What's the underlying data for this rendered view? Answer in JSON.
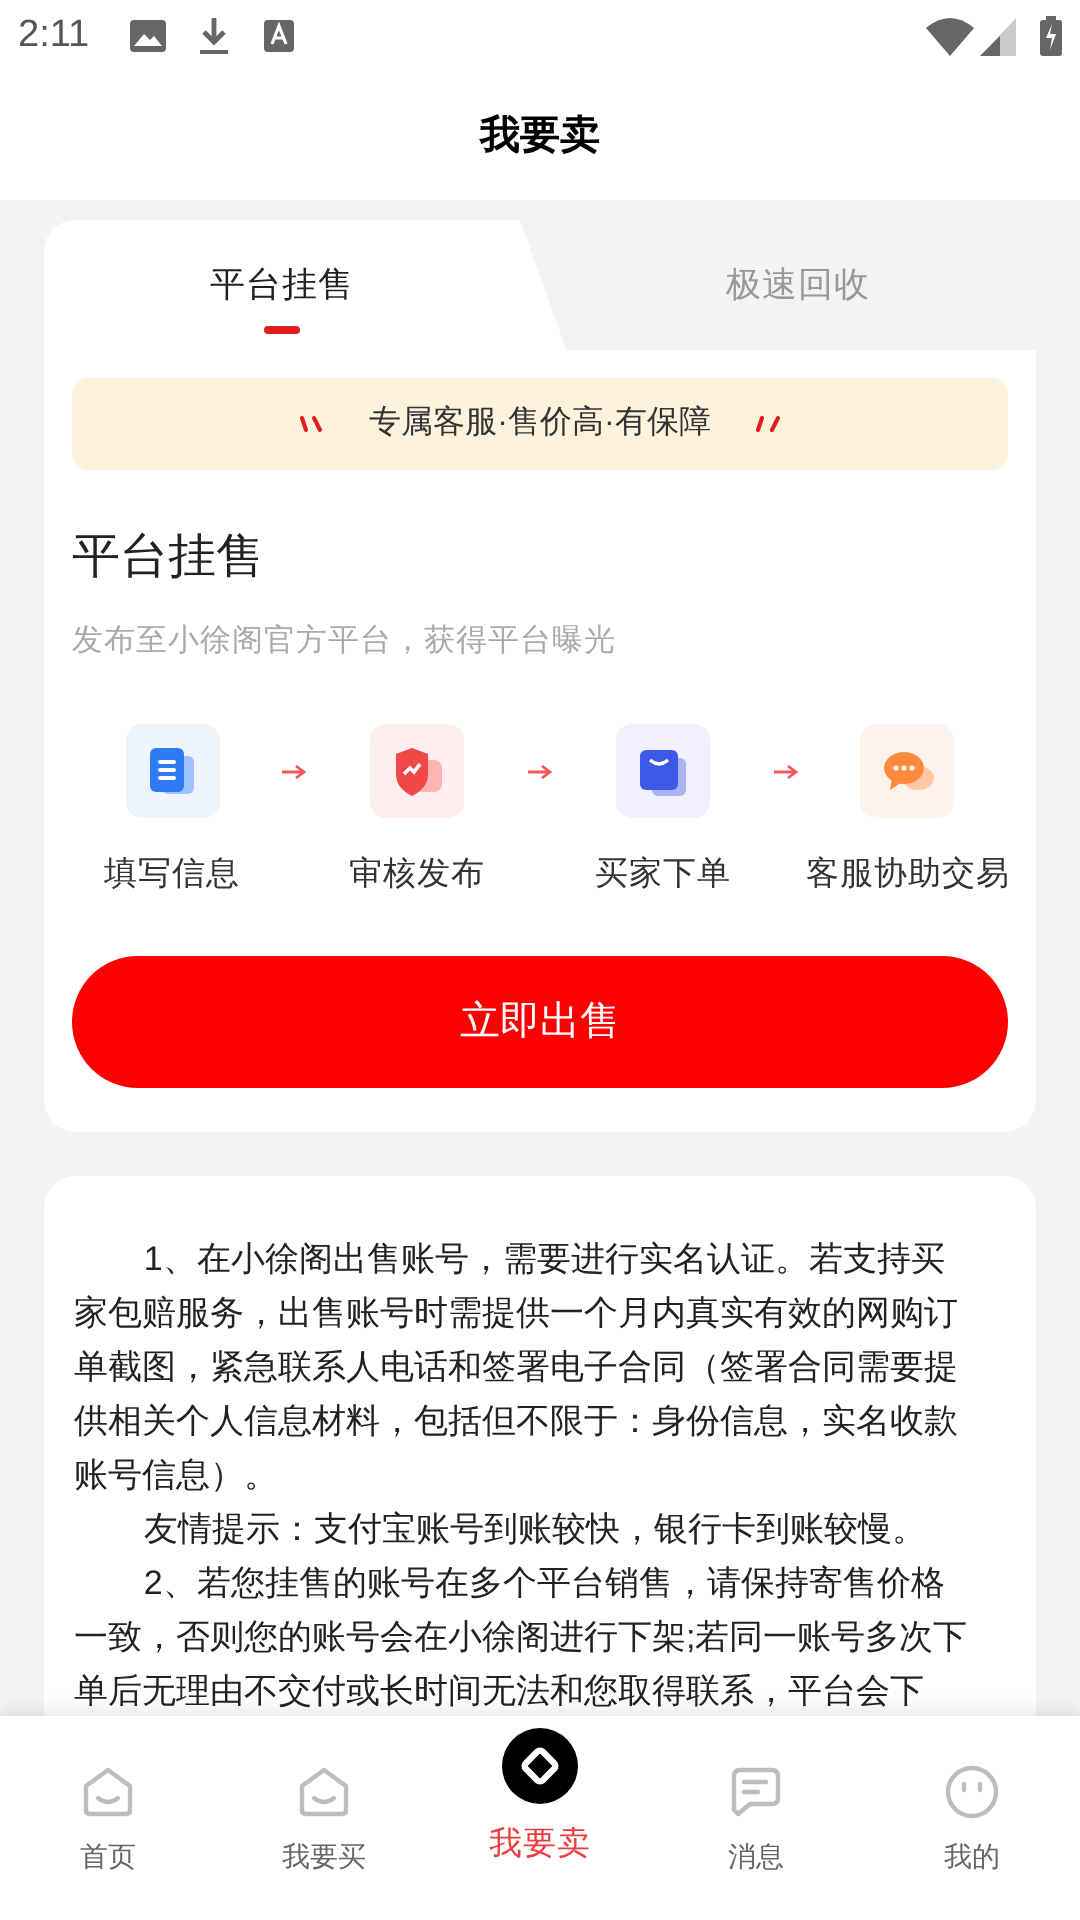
{
  "status_bar": {
    "time": "2:11"
  },
  "header": {
    "title": "我要卖"
  },
  "tabs": [
    {
      "label": "平台挂售",
      "selected": true
    },
    {
      "label": "极速回收",
      "selected": false
    }
  ],
  "banner": {
    "text": "专属客服·售价高·有保障"
  },
  "section": {
    "title": "平台挂售",
    "subtitle": "发布至小徐阁官方平台，获得平台曝光"
  },
  "steps": [
    {
      "label": "填写信息",
      "kind": "document",
      "color": "#eef5ff"
    },
    {
      "label": "审核发布",
      "kind": "shield",
      "color": "#ffeeee"
    },
    {
      "label": "买家下单",
      "kind": "bag",
      "color": "#f0f0ff"
    },
    {
      "label": "客服协助交易",
      "kind": "chat",
      "color": "#fff3ec"
    }
  ],
  "primary_button": "立即出售",
  "notice": [
    "1、在小徐阁出售账号，需要进行实名认证。若支持买家包赔服务，出售账号时需提供一个月内真实有效的网购订单截图，紧急联系人电话和签署电子合同（签署合同需要提供相关个人信息材料，包括但不限于：身份信息，实名收款账号信息）。",
    "友情提示：支付宝账号到账较快，银行卡到账较慢。",
    "2、若您挂售的账号在多个平台销售，请保持寄售价格一致，否则您的账号会在小徐阁进行下架;若同一账号多次下单后无理由不交付或长时间无法和您取得联系，平台会下"
  ],
  "bottom_nav": [
    {
      "label": "首页",
      "kind": "home",
      "selected": false
    },
    {
      "label": "我要买",
      "kind": "home",
      "selected": false
    },
    {
      "label": "我要卖",
      "kind": "sell",
      "selected": true
    },
    {
      "label": "消息",
      "kind": "message",
      "selected": false
    },
    {
      "label": "我的",
      "kind": "face",
      "selected": false
    }
  ]
}
